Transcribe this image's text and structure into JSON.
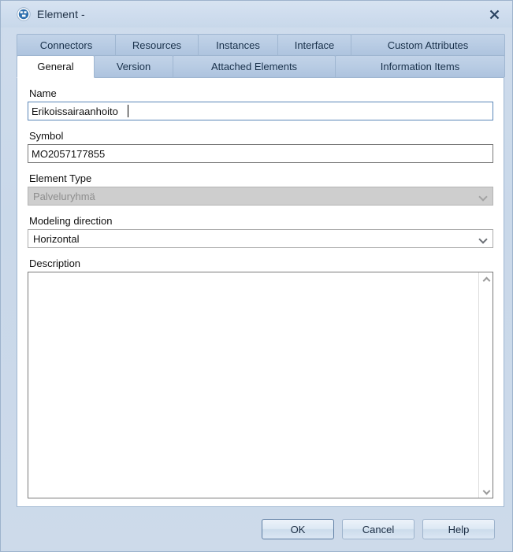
{
  "window": {
    "title": "Element -",
    "icon": "element-icon",
    "close_label": "✕"
  },
  "tabs": {
    "row1": [
      {
        "label": "Connectors",
        "active": false
      },
      {
        "label": "Resources",
        "active": false
      },
      {
        "label": "Instances",
        "active": false
      },
      {
        "label": "Interface",
        "active": false
      },
      {
        "label": "Custom Attributes",
        "active": false
      }
    ],
    "row2": [
      {
        "label": "General",
        "active": true
      },
      {
        "label": "Version",
        "active": false
      },
      {
        "label": "Attached Elements",
        "active": false
      },
      {
        "label": "Information Items",
        "active": false
      }
    ]
  },
  "general": {
    "name": {
      "label": "Name",
      "value": "Erikoissairaanhoito",
      "placeholder": ""
    },
    "symbol": {
      "label": "Symbol",
      "value": "MO2057177855",
      "placeholder": ""
    },
    "element_type": {
      "label": "Element Type",
      "value": "Palveluryhmä",
      "disabled": true,
      "arrow": "chevron-down-icon"
    },
    "modeling_direction": {
      "label": "Modeling direction",
      "value": "Horizontal",
      "disabled": false,
      "arrow": "chevron-down-icon"
    },
    "description": {
      "label": "Description",
      "value": "",
      "placeholder": ""
    }
  },
  "footer": {
    "ok_label": "OK",
    "cancel_label": "Cancel",
    "help_label": "Help"
  },
  "colors": {
    "window_chrome": "#cfdcec",
    "tab_inactive": "#b7cbe3",
    "tab_active": "#ffffff",
    "border": "#9fb6d1",
    "focus_border": "#5b87b8",
    "disabled_bg": "#cecece"
  }
}
